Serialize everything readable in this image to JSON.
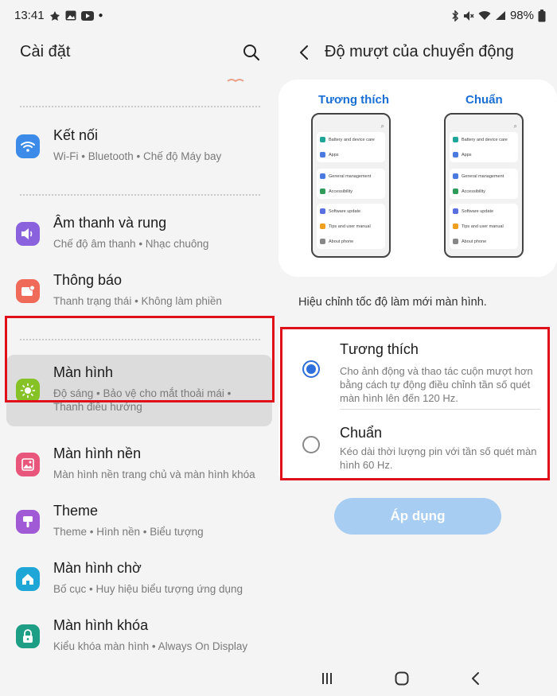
{
  "status_bar": {
    "time": "13:41",
    "left_icons": [
      "activity-icon",
      "gallery-icon",
      "youtube-icon",
      "dot-icon"
    ],
    "right_icons": [
      "bluetooth-icon",
      "mute-icon",
      "wifi-icon",
      "signal-icon"
    ],
    "battery": "98%"
  },
  "left": {
    "title": "Cài đặt",
    "items": [
      {
        "title": "Kết nối",
        "subtitle": "Wi-Fi  •  Bluetooth  •  Chế độ Máy bay",
        "icon": "wifi-icon",
        "color": "#3d8be8"
      },
      {
        "title": "Âm thanh và rung",
        "subtitle": "Chế độ âm thanh  •  Nhạc chuông",
        "icon": "volume-icon",
        "color": "#8a62dd"
      },
      {
        "title": "Thông báo",
        "subtitle": "Thanh trạng thái  •  Không làm phiền",
        "icon": "notification-icon",
        "color": "#f06a5a"
      },
      {
        "title": "Màn hình",
        "subtitle": "Độ sáng  •  Bảo vệ cho mắt thoải mái  •  Thanh điều hướng",
        "icon": "brightness-icon",
        "color": "#86c126"
      },
      {
        "title": "Màn hình nền",
        "subtitle": "Màn hình nền trang chủ và màn hình khóa",
        "icon": "wallpaper-icon",
        "color": "#e8567c"
      },
      {
        "title": "Theme",
        "subtitle": "Theme  •  Hình nền  •  Biểu tượng",
        "icon": "theme-icon",
        "color": "#a15ad6"
      },
      {
        "title": "Màn hình chờ",
        "subtitle": "Bố cục  •  Huy hiệu biểu tượng ứng dụng",
        "icon": "home-screen-icon",
        "color": "#1ea7d6"
      },
      {
        "title": "Màn hình khóa",
        "subtitle": "Kiểu khóa màn hình  •  Always On Display",
        "icon": "lock-icon",
        "color": "#1d9e85"
      }
    ]
  },
  "right": {
    "title": "Độ mượt của chuyển động",
    "preview": {
      "left_label": "Tương thích",
      "right_label": "Chuẩn",
      "phone_rows": [
        [
          "Battery and device care",
          "Apps"
        ],
        [
          "General management",
          "Accessibility"
        ],
        [
          "Software update",
          "Tips and user manual",
          "About phone"
        ]
      ],
      "row_colors": [
        [
          "#1fa59a",
          "#4a7ae0"
        ],
        [
          "#4a7ae0",
          "#2e9b58"
        ],
        [
          "#5a6fe0",
          "#f0a020",
          "#888888"
        ]
      ]
    },
    "description": "Hiệu chỉnh tốc độ làm mới màn hình.",
    "options": [
      {
        "title": "Tương thích",
        "desc": "Cho ảnh động và thao tác cuộn mượt hơn bằng cách tự động điều chỉnh tần số quét màn hình lên đến 120 Hz.",
        "selected": true
      },
      {
        "title": "Chuẩn",
        "desc": "Kéo dài thời lượng pin với tần số quét màn hình 60 Hz.",
        "selected": false
      }
    ],
    "apply_label": "Áp dụng"
  },
  "colors": {
    "accent": "#2f6fdc",
    "preview_label": "#1a6fd6",
    "highlight": "#e0101a",
    "apply_bg": "#a7cdf3"
  },
  "nav": [
    "recents-icon",
    "home-icon",
    "back-icon"
  ]
}
